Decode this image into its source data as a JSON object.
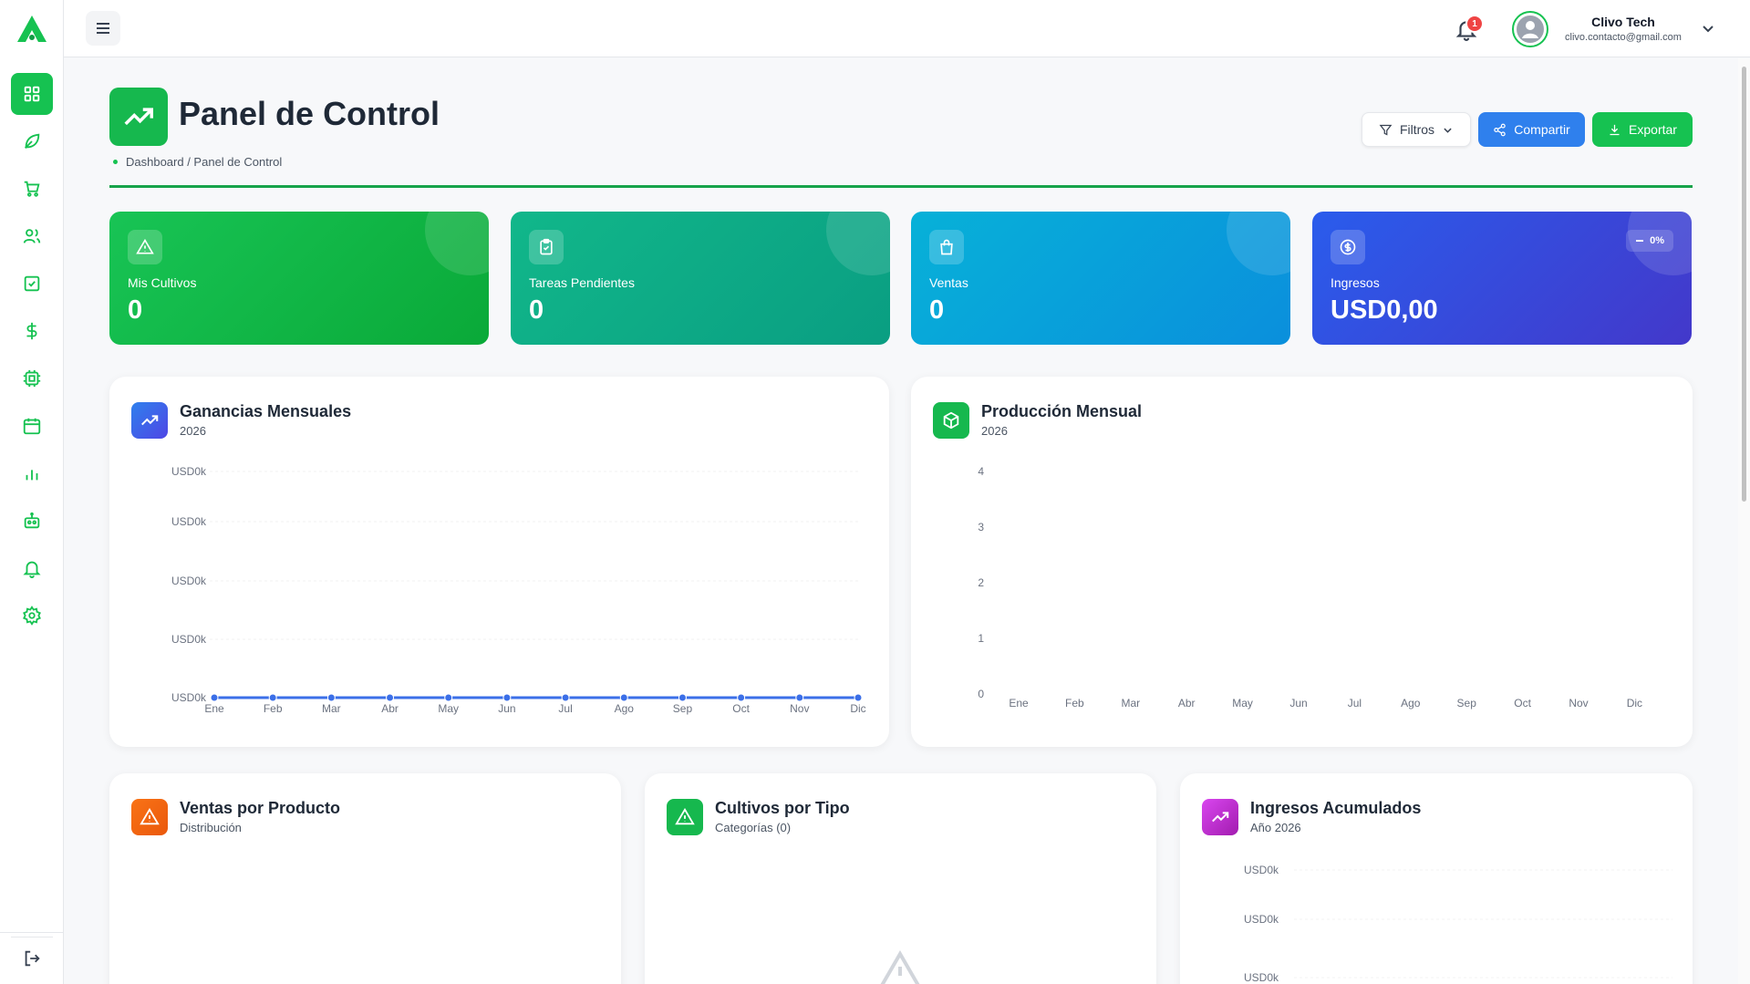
{
  "app": {
    "logo_icon": "app-logo-icon",
    "brand_color": "#16c251"
  },
  "sidebar": {
    "items": [
      {
        "icon": "dashboard-grid-icon",
        "active": true
      },
      {
        "icon": "leaf-icon",
        "active": false
      },
      {
        "icon": "cart-icon",
        "active": false
      },
      {
        "icon": "users-icon",
        "active": false
      },
      {
        "icon": "task-check-icon",
        "active": false
      },
      {
        "icon": "dollar-icon",
        "active": false
      },
      {
        "icon": "chip-icon",
        "active": false
      },
      {
        "icon": "calendar-icon",
        "active": false
      },
      {
        "icon": "bar-chart-icon",
        "active": false
      },
      {
        "icon": "robot-icon",
        "active": false
      },
      {
        "icon": "bell-icon",
        "active": false
      },
      {
        "icon": "settings-icon",
        "active": false
      }
    ],
    "logout_icon": "logout-icon"
  },
  "header": {
    "notifications_count": "1",
    "user_name": "Clivo Tech",
    "user_email": "clivo.contacto@gmail.com"
  },
  "page": {
    "title": "Panel de Control",
    "breadcrumb": "Dashboard / Panel de Control",
    "buttons": {
      "filter": "Filtros",
      "share": "Compartir",
      "export": "Exportar"
    }
  },
  "stats": [
    {
      "label": "Mis Cultivos",
      "value": "0",
      "icon": "warning-triangle-icon"
    },
    {
      "label": "Tareas Pendientes",
      "value": "0",
      "icon": "clipboard-check-icon"
    },
    {
      "label": "Ventas",
      "value": "0",
      "icon": "shopping-bag-icon"
    },
    {
      "label": "Ingresos",
      "value": "USD0,00",
      "icon": "dollar-circle-icon",
      "trend": "0%"
    }
  ],
  "cards": {
    "monthly_profit": {
      "title": "Ganancias Mensuales",
      "subtitle": "2026"
    },
    "monthly_production": {
      "title": "Producción Mensual",
      "subtitle": "2026"
    },
    "sales_by_product": {
      "title": "Ventas por Producto",
      "subtitle": "Distribución"
    },
    "crops_by_type": {
      "title": "Cultivos por Tipo",
      "subtitle": "Categorías (0)"
    },
    "cumulative_income": {
      "title": "Ingresos Acumulados",
      "subtitle": "Año 2026"
    }
  },
  "chart_data": [
    {
      "type": "line",
      "categories": [
        "Ene",
        "Feb",
        "Mar",
        "Abr",
        "May",
        "Jun",
        "Jul",
        "Ago",
        "Sep",
        "Oct",
        "Nov",
        "Dic"
      ],
      "values": [
        0,
        0,
        0,
        0,
        0,
        0,
        0,
        0,
        0,
        0,
        0,
        0
      ],
      "y_tick_labels": [
        "USD0k",
        "USD0k",
        "USD0k",
        "USD0k",
        "USD0k"
      ],
      "color": "#3b6fe8",
      "grid": true
    },
    {
      "type": "bar",
      "categories": [
        "Ene",
        "Feb",
        "Mar",
        "Abr",
        "May",
        "Jun",
        "Jul",
        "Ago",
        "Sep",
        "Oct",
        "Nov",
        "Dic"
      ],
      "values": [
        0,
        0,
        0,
        0,
        0,
        0,
        0,
        0,
        0,
        0,
        0,
        0
      ],
      "y_tick_labels": [
        "4",
        "3",
        "2",
        "1",
        "0"
      ],
      "ylim": [
        0,
        4
      ]
    },
    {
      "type": "area",
      "y_tick_labels": [
        "USD0k",
        "USD0k",
        "USD0k"
      ]
    }
  ]
}
